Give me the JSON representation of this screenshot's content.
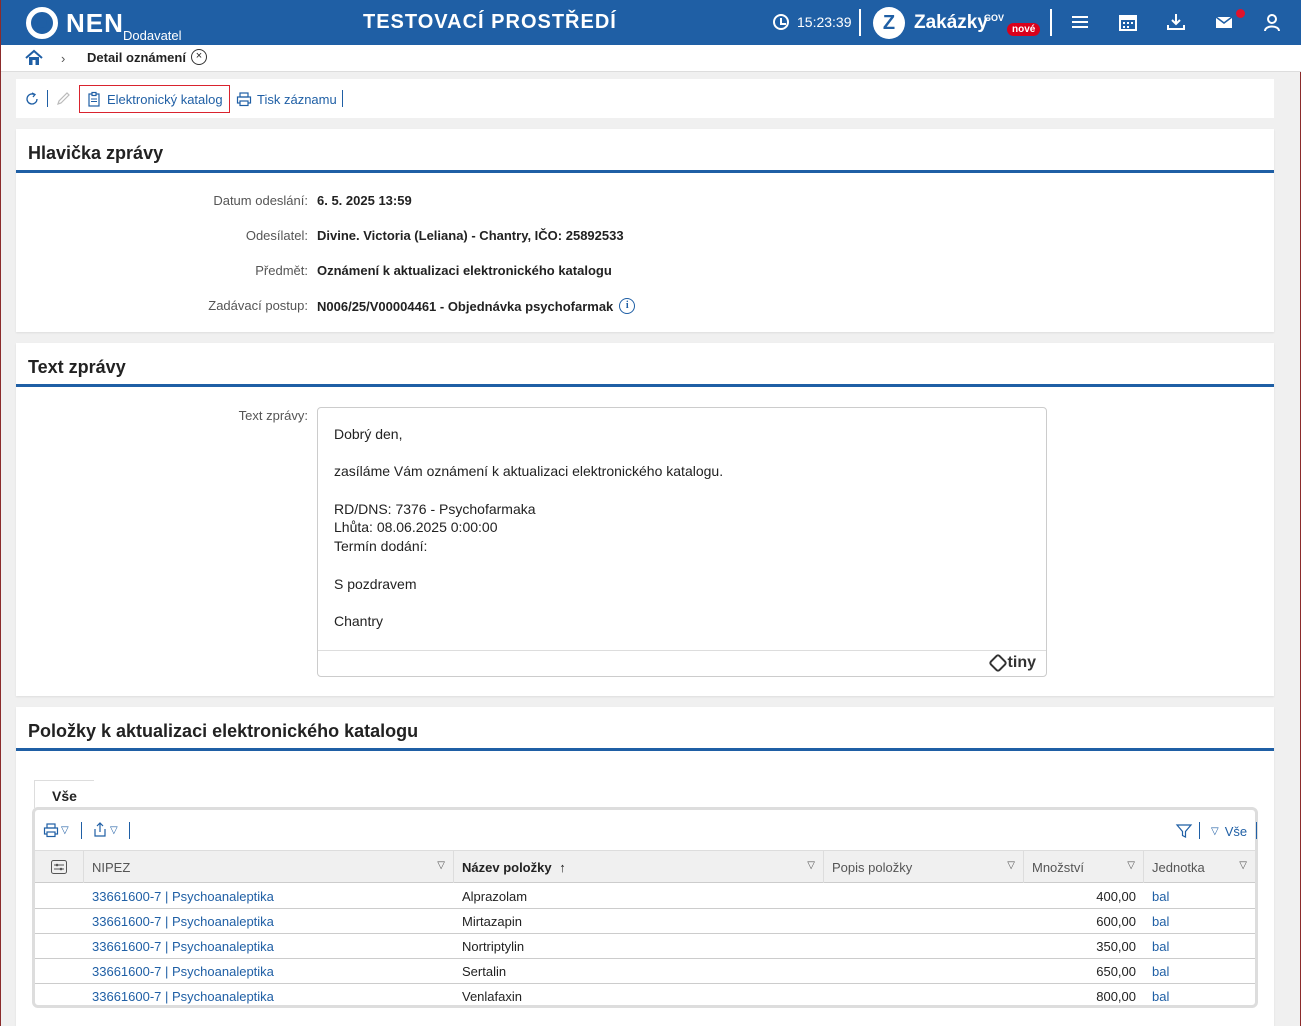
{
  "header": {
    "logo_text": "NEN",
    "logo_sub": "Dodavatel",
    "env_title": "TESTOVACÍ PROSTŘEDÍ",
    "clock": "15:23:39",
    "zakazky": "Zakázky",
    "zakazky_gov": "GOV",
    "zakazky_badge": "nové"
  },
  "breadcrumb": {
    "current": "Detail oznámení"
  },
  "toolbar": {
    "catalog_label": "Elektronický katalog",
    "print_label": "Tisk záznamu"
  },
  "header_panel": {
    "title": "Hlavička zprávy",
    "fields": [
      {
        "label": "Datum odeslání:",
        "value": "6. 5. 2025 13:59"
      },
      {
        "label": "Odesílatel:",
        "value": "Divine. Victoria (Leliana) - Chantry, IČO: 25892533"
      },
      {
        "label": "Předmět:",
        "value": "Oznámení k aktualizaci elektronického katalogu"
      },
      {
        "label": "Zadávací postup:",
        "value": "N006/25/V00004461 - Objednávka psychofarmak"
      }
    ]
  },
  "text_panel": {
    "title": "Text zprávy",
    "label": "Text zprávy:",
    "lines": [
      "Dobrý den,",
      "",
      "zasíláme Vám oznámení k aktualizaci elektronického katalogu.",
      "",
      "RD/DNS: 7376 - Psychofarmaka",
      "Lhůta: 08.06.2025 0:00:00",
      "Termín dodání:",
      "",
      "S pozdravem",
      "",
      "Chantry"
    ],
    "editor_brand": "tiny"
  },
  "items_panel": {
    "title": "Položky k aktualizaci elektronického katalogu",
    "tab": "Vše",
    "filter_label": "Vše",
    "columns": [
      "NIPEZ",
      "Název položky",
      "Popis položky",
      "Množství",
      "Jednotka"
    ],
    "rows": [
      {
        "nipez": "33661600-7 | Psychoanaleptika",
        "name": "Alprazolam",
        "desc": "",
        "qty": "400,00",
        "unit": "bal"
      },
      {
        "nipez": "33661600-7 | Psychoanaleptika",
        "name": "Mirtazapin",
        "desc": "",
        "qty": "600,00",
        "unit": "bal"
      },
      {
        "nipez": "33661600-7 | Psychoanaleptika",
        "name": "Nortriptylin",
        "desc": "",
        "qty": "350,00",
        "unit": "bal"
      },
      {
        "nipez": "33661600-7 | Psychoanaleptika",
        "name": "Sertalin",
        "desc": "",
        "qty": "650,00",
        "unit": "bal"
      },
      {
        "nipez": "33661600-7 | Psychoanaleptika",
        "name": "Venlafaxin",
        "desc": "",
        "qty": "800,00",
        "unit": "bal"
      }
    ]
  },
  "colors": {
    "brand_blue": "#1f5fa5",
    "badge_red": "#d9001b",
    "highlight_border": "#d9232e"
  }
}
